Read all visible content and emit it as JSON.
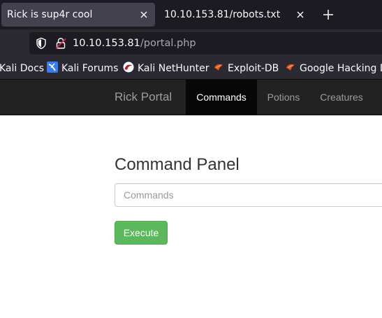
{
  "browser": {
    "tabs": [
      {
        "title": "Rick is sup4r cool",
        "active": true,
        "close_icon": "close-icon"
      },
      {
        "title": "10.10.153.81/robots.txt",
        "active": false,
        "close_icon": "close-icon"
      }
    ],
    "new_tab_icon": "plus-icon",
    "url": {
      "host": "10.10.153.81",
      "path": "/portal.php"
    },
    "bookmarks": [
      {
        "label": "Kali Docs",
        "icon": "none"
      },
      {
        "label": "Kali Forums",
        "icon": "kali-forums-icon"
      },
      {
        "label": "Kali NetHunter",
        "icon": "kali-nethunter-icon"
      },
      {
        "label": "Exploit-DB",
        "icon": "exploit-db-icon"
      },
      {
        "label": "Google Hacking D",
        "icon": "exploit-db-icon"
      }
    ]
  },
  "site": {
    "brand": "Rick Portal",
    "nav": [
      {
        "label": "Commands",
        "active": true
      },
      {
        "label": "Potions",
        "active": false
      },
      {
        "label": "Creatures",
        "active": false
      }
    ],
    "panel": {
      "title": "Command Panel",
      "input_placeholder": "Commands",
      "input_value": "",
      "button_label": "Execute"
    }
  },
  "colors": {
    "tabstrip_bg": "#1c1b22",
    "toolbar_bg": "#2b2a33",
    "site_nav_bg": "#222222",
    "button_green": "#5cb85c"
  }
}
